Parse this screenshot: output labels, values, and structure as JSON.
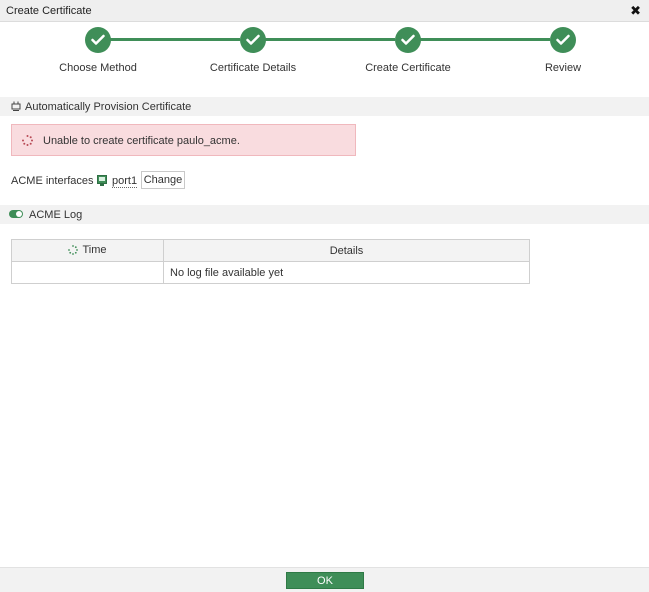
{
  "dialog": {
    "title": "Create Certificate",
    "close_glyph": "✖"
  },
  "wizard": {
    "steps": [
      {
        "label": "Choose Method",
        "status": "complete"
      },
      {
        "label": "Certificate Details",
        "status": "complete"
      },
      {
        "label": "Create Certificate",
        "status": "complete"
      },
      {
        "label": "Review",
        "status": "complete"
      }
    ],
    "accent_color": "#3f8e58"
  },
  "provision_section": {
    "title": "Automatically Provision Certificate",
    "icon": "certificate-icon"
  },
  "alert": {
    "message": "Unable to create certificate paulo_acme.",
    "icon": "spinner-icon",
    "background_color": "#f9dcdf"
  },
  "acme_interfaces": {
    "label": "ACME interfaces",
    "interface_name": "port1",
    "change_label": "Change"
  },
  "acme_log": {
    "title": "ACME Log",
    "toggle_enabled": true,
    "columns": [
      "Time",
      "Details"
    ],
    "rows": [
      {
        "time": "",
        "details": "No log file available yet"
      }
    ]
  },
  "footer": {
    "ok_label": "OK"
  }
}
